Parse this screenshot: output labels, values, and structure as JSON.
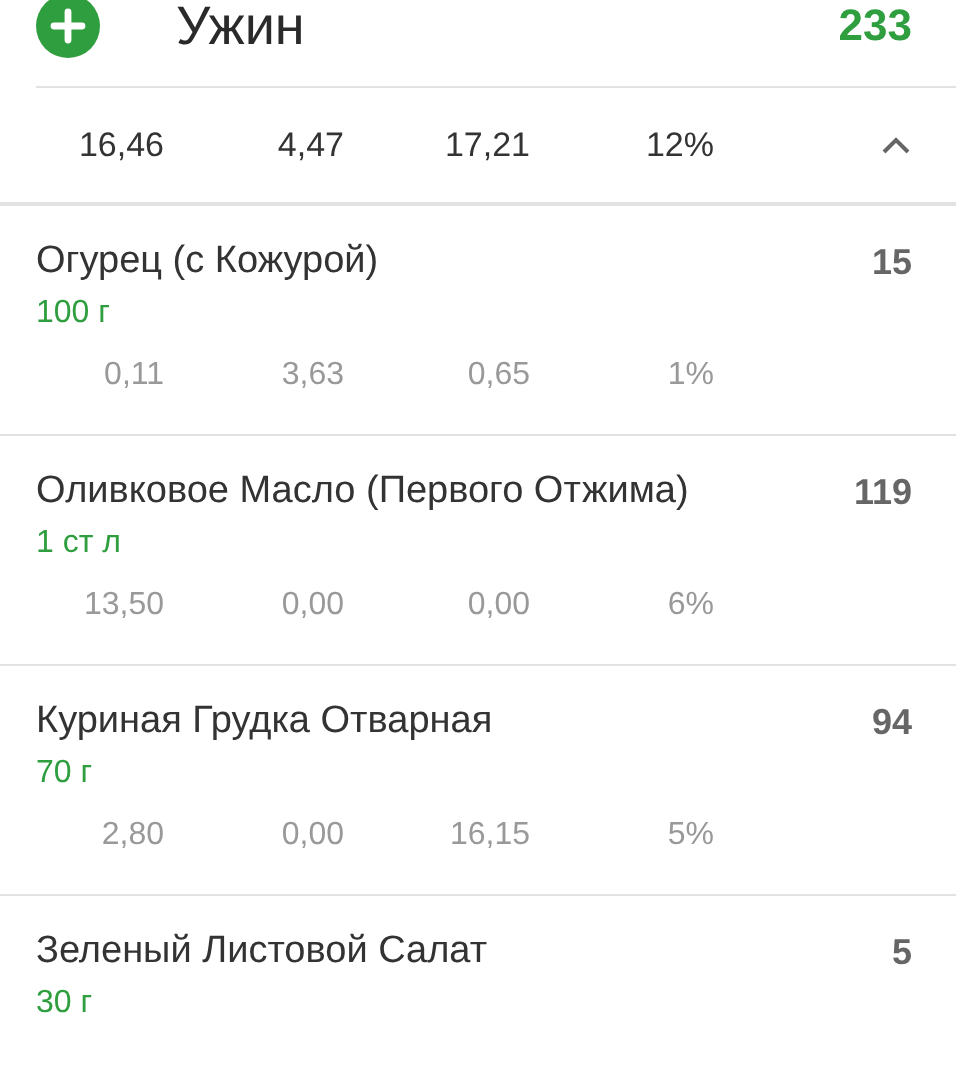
{
  "meal": {
    "title": "Ужин",
    "calories": "233",
    "expanded": true
  },
  "totals": [
    "16,46",
    "4,47",
    "17,21",
    "12%"
  ],
  "items": [
    {
      "name": "Огурец (с Кожурой)",
      "calories": "15",
      "portion": "100 г",
      "macros": [
        "0,11",
        "3,63",
        "0,65",
        "1%"
      ]
    },
    {
      "name": "Оливковое Масло (Первого Отжима)",
      "calories": "119",
      "portion": "1 ст л",
      "macros": [
        "13,50",
        "0,00",
        "0,00",
        "6%"
      ]
    },
    {
      "name": "Куриная Грудка Отварная",
      "calories": "94",
      "portion": "70  г",
      "macros": [
        "2,80",
        "0,00",
        "16,15",
        "5%"
      ]
    },
    {
      "name": "Зеленый Листовой Салат",
      "calories": "5",
      "portion": "30  г"
    }
  ]
}
